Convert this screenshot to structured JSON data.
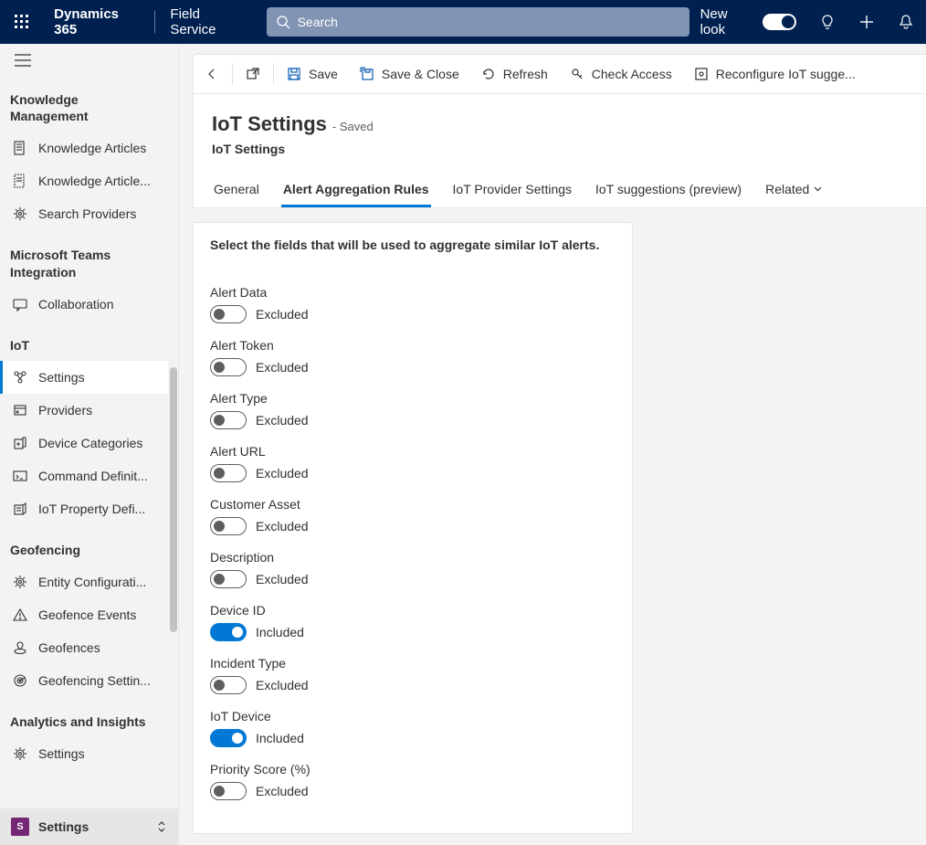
{
  "topbar": {
    "brand": "Dynamics 365",
    "app": "Field Service",
    "search_placeholder": "Search",
    "newlook": "New look"
  },
  "cmdbar": {
    "save": "Save",
    "saveclose": "Save & Close",
    "refresh": "Refresh",
    "check": "Check Access",
    "reconfig": "Reconfigure IoT sugge..."
  },
  "header": {
    "title": "IoT Settings",
    "saved": "- Saved",
    "subtitle": "IoT Settings",
    "tabs": [
      "General",
      "Alert Aggregation Rules",
      "IoT Provider Settings",
      "IoT suggestions (preview)",
      "Related"
    ],
    "active_tab": 1
  },
  "panel": {
    "desc": "Select the fields that will be used to aggregate similar IoT alerts.",
    "on_label": "Included",
    "off_label": "Excluded",
    "fields": [
      {
        "label": "Alert Data",
        "on": false
      },
      {
        "label": "Alert Token",
        "on": false
      },
      {
        "label": "Alert Type",
        "on": false
      },
      {
        "label": "Alert URL",
        "on": false
      },
      {
        "label": "Customer Asset",
        "on": false
      },
      {
        "label": "Description",
        "on": false
      },
      {
        "label": "Device ID",
        "on": true
      },
      {
        "label": "Incident Type",
        "on": false
      },
      {
        "label": "IoT Device",
        "on": true
      },
      {
        "label": "Priority Score (%)",
        "on": false
      }
    ]
  },
  "sidebar": {
    "groups": [
      {
        "heading": "Knowledge Management",
        "items": [
          {
            "label": "Knowledge Articles",
            "icon": "article"
          },
          {
            "label": "Knowledge Article...",
            "icon": "template"
          },
          {
            "label": "Search Providers",
            "icon": "gear"
          }
        ]
      },
      {
        "heading": "Microsoft Teams Integration",
        "items": [
          {
            "label": "Collaboration",
            "icon": "chat"
          }
        ]
      },
      {
        "heading": "IoT",
        "items": [
          {
            "label": "Settings",
            "icon": "iot",
            "active": true
          },
          {
            "label": "Providers",
            "icon": "provider"
          },
          {
            "label": "Device Categories",
            "icon": "device"
          },
          {
            "label": "Command Definit...",
            "icon": "command"
          },
          {
            "label": "IoT Property Defi...",
            "icon": "property"
          }
        ]
      },
      {
        "heading": "Geofencing",
        "items": [
          {
            "label": "Entity Configurati...",
            "icon": "gear"
          },
          {
            "label": "Geofence Events",
            "icon": "warning"
          },
          {
            "label": "Geofences",
            "icon": "geofence"
          },
          {
            "label": "Geofencing Settin...",
            "icon": "radar"
          }
        ]
      },
      {
        "heading": "Analytics and Insights",
        "items": [
          {
            "label": "Settings",
            "icon": "gear"
          }
        ]
      }
    ],
    "area": {
      "badge": "S",
      "label": "Settings"
    }
  }
}
